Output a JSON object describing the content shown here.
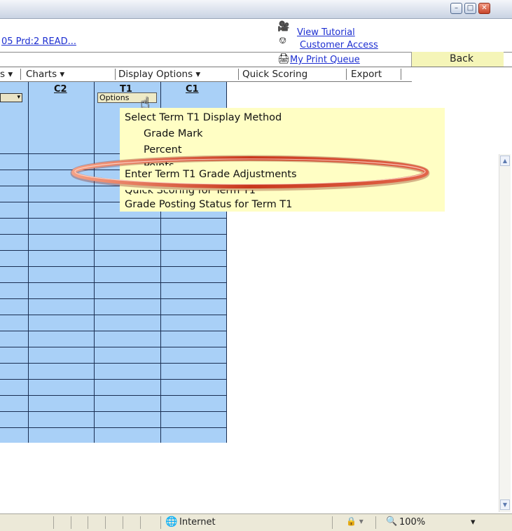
{
  "window": {
    "controls": [
      "minimize",
      "maximize",
      "close"
    ]
  },
  "header": {
    "period_link": "05 Prd:2 READ...",
    "view_tutorial": "View Tutorial",
    "customer_access": "Customer Access",
    "my_print_queue": "My Print Queue",
    "back": "Back"
  },
  "menubar": {
    "items": [
      "s ▾",
      "Charts ▾",
      "Display Options ▾",
      "Quick Scoring",
      "Export"
    ]
  },
  "grid": {
    "columns": [
      "C2",
      "T1",
      "C1"
    ],
    "options_button": "Options",
    "left_dropdown_glyph": "▾",
    "row_count": 18,
    "colors": {
      "cell_bg": "#a9d0f7",
      "line": "#1a2e52"
    }
  },
  "popup": {
    "title": "Select Term T1 Display Method",
    "items": [
      "Grade Mark",
      "Percent",
      "Points",
      "Enter Term T1 Grade Adjustments",
      "Quick Scoring for Term T1",
      "Grade Posting Status for Term T1"
    ],
    "highlighted": "Enter Term T1 Grade Adjustments",
    "colors": {
      "bg": "#fffec4",
      "highlight_ring": "#d23a1c"
    }
  },
  "statusbar": {
    "zone": "Internet",
    "zoom": "100%"
  }
}
